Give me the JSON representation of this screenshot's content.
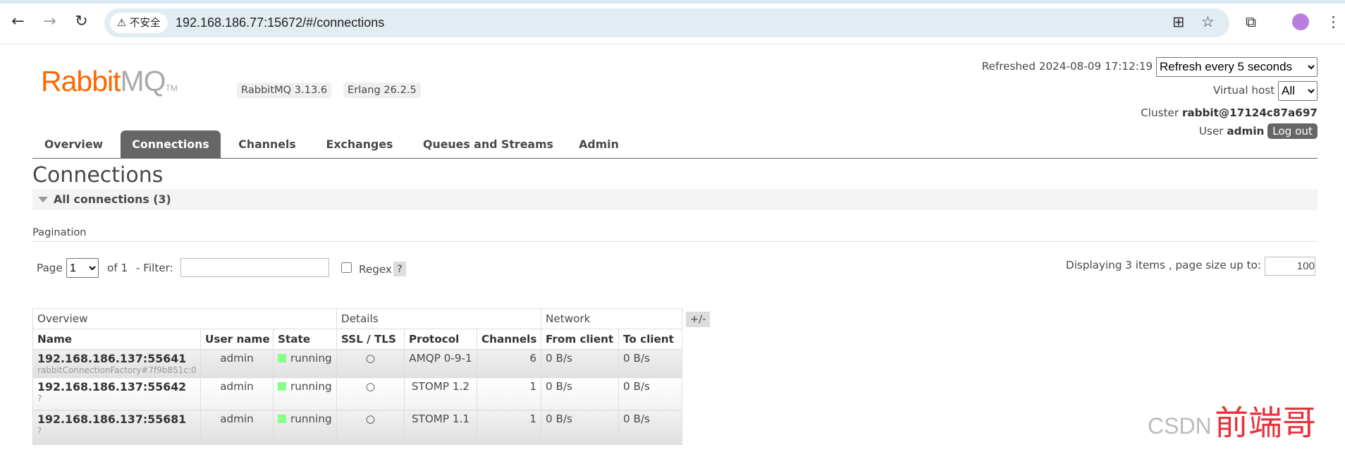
{
  "browser": {
    "security_label": "不安全",
    "url": "192.168.186.77:15672/#/connections"
  },
  "header": {
    "logo": {
      "rabbit": "Rabbit",
      "mq": "MQ",
      "tm": "TM"
    },
    "rabbitmq_version": "RabbitMQ 3.13.6",
    "erlang_version": "Erlang 26.2.5",
    "refreshed_label": "Refreshed",
    "refreshed_time": "2024-08-09 17:12:19",
    "refresh_option": "Refresh every 5 seconds",
    "vhost_label": "Virtual host",
    "vhost_value": "All",
    "cluster_label": "Cluster",
    "cluster_name": "rabbit@17124c87a697",
    "user_label": "User",
    "user_name": "admin",
    "logout": "Log out"
  },
  "tabs": [
    {
      "label": "Overview"
    },
    {
      "label": "Connections",
      "active": true
    },
    {
      "label": "Channels"
    },
    {
      "label": "Exchanges"
    },
    {
      "label": "Queues and Streams"
    },
    {
      "label": "Admin"
    }
  ],
  "main": {
    "title": "Connections",
    "section": "All connections (3)",
    "pagination_label": "Pagination",
    "page_label": "Page",
    "page_value": "1",
    "of_label": "of 1",
    "filter_label": "- Filter:",
    "filter_value": "",
    "regex_label": "Regex",
    "help": "?",
    "displaying": "Displaying 3 items , page size up to:",
    "page_size": "100",
    "toggle_columns": "+/-"
  },
  "table": {
    "groups": [
      "Overview",
      "Details",
      "Network"
    ],
    "columns": [
      "Name",
      "User name",
      "State",
      "SSL / TLS",
      "Protocol",
      "Channels",
      "From client",
      "To client"
    ],
    "rows": [
      {
        "name": "192.168.186.137:55641",
        "client": "rabbitConnectionFactory#7f9b851c:0",
        "user": "admin",
        "state": "running",
        "ssl": "○",
        "protocol": "AMQP 0-9-1",
        "channels": "6",
        "from": "0 B/s",
        "to": "0 B/s"
      },
      {
        "name": "192.168.186.137:55642",
        "client": "?",
        "user": "admin",
        "state": "running",
        "ssl": "○",
        "protocol": "STOMP 1.2",
        "channels": "1",
        "from": "0 B/s",
        "to": "0 B/s"
      },
      {
        "name": "192.168.186.137:55681",
        "client": "?",
        "user": "admin",
        "state": "running",
        "ssl": "○",
        "protocol": "STOMP 1.1",
        "channels": "1",
        "from": "0 B/s",
        "to": "0 B/s"
      }
    ]
  },
  "watermark": {
    "text": "CSDN",
    "author": "前端哥"
  },
  "colors": {
    "brand": "#ff6600",
    "active_tab": "#666666",
    "running": "#88ff88"
  }
}
